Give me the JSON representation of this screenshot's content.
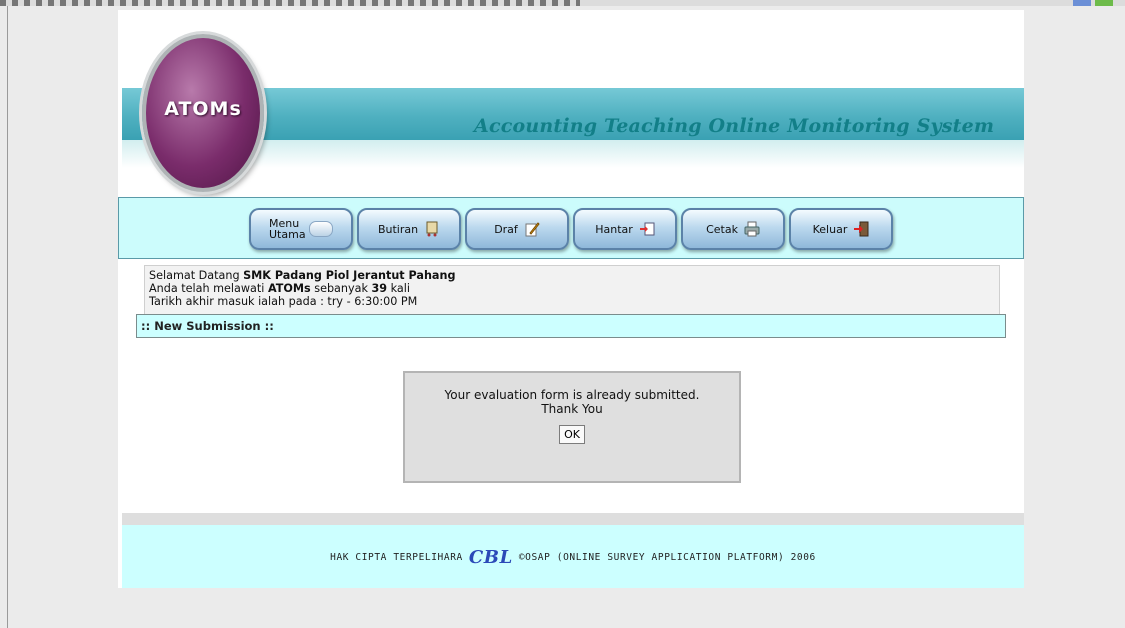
{
  "header": {
    "logo_text": "ATOMs",
    "system_title": "Accounting Teaching Online Monitoring System"
  },
  "nav": {
    "items": [
      {
        "label": "Menu Utama",
        "icon": "menu-icon"
      },
      {
        "label": "Butiran",
        "icon": "cart-icon"
      },
      {
        "label": "Draf",
        "icon": "draft-pencil-icon"
      },
      {
        "label": "Hantar",
        "icon": "send-document-icon"
      },
      {
        "label": "Cetak",
        "icon": "printer-icon"
      },
      {
        "label": "Keluar",
        "icon": "exit-door-icon"
      }
    ]
  },
  "info": {
    "welcome_prefix": "Selamat Datang ",
    "school": "SMK Padang Piol Jerantut Pahang",
    "visit_prefix": "Anda telah melawati ",
    "app_name": "ATOMs",
    "visit_middle": " sebanyak ",
    "visit_count": "39",
    "visit_suffix": " kali",
    "last_login": "Tarikh akhir masuk ialah pada : try - 6:30:00 PM"
  },
  "submission_title": ":: New Submission ::",
  "dialog": {
    "message_line1": "Your evaluation form is already submitted.",
    "message_line2": "Thank You",
    "ok_label": "OK"
  },
  "footer": {
    "copyright_left": "HAK CIPTA TERPELIHARA",
    "brand": "CBL",
    "copyright_right": "©OSAP (ONLINE SURVEY APPLICATION PLATFORM) 2006"
  },
  "colors": {
    "banner": "#4fb0c0",
    "nav_bg": "#ccfcfc",
    "accent_text": "#127f88",
    "logo_purple": "#7a2c6b"
  }
}
